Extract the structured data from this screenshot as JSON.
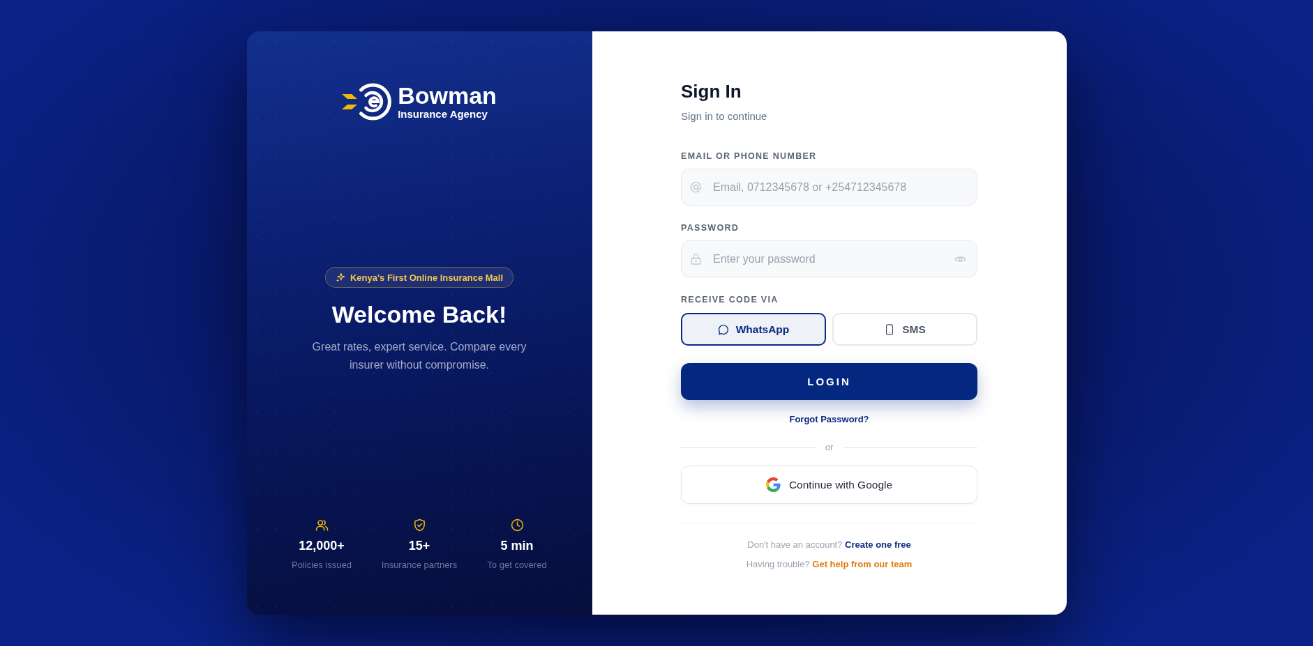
{
  "brand": {
    "name": "Bowman",
    "tagline": "Insurance Agency"
  },
  "hero": {
    "badge": "Kenya's First Online Insurance Mall",
    "title": "Welcome Back!",
    "subtitle": "Great rates, expert service. Compare every insurer without compromise."
  },
  "stats": [
    {
      "kind": "users",
      "value": "12,000+",
      "label": "Policies issued"
    },
    {
      "kind": "shield",
      "value": "15+",
      "label": "Insurance partners"
    },
    {
      "kind": "clock",
      "value": "5 min",
      "label": "To get covered"
    }
  ],
  "form": {
    "title": "Sign In",
    "subtitle": "Sign in to continue",
    "fields": [
      {
        "kind": "email",
        "label": "EMAIL OR PHONE NUMBER",
        "placeholder": "Email, 0712345678 or +254712345678"
      },
      {
        "kind": "password",
        "label": "PASSWORD",
        "placeholder": "Enter your password"
      }
    ],
    "code_channel": {
      "label": "RECEIVE CODE VIA",
      "options": [
        {
          "kind": "chat",
          "label": "WhatsApp",
          "selected": true
        },
        {
          "kind": "phone",
          "label": "SMS",
          "selected": false
        }
      ]
    },
    "submit": "LOGIN",
    "forgot": "Forgot Password?",
    "divider": "or",
    "google": "Continue with Google",
    "footer": [
      {
        "kind": "signup",
        "prompt": "Don't have an account?",
        "link": "Create one free"
      },
      {
        "kind": "help",
        "prompt": "Having trouble?",
        "link": "Get help from our team"
      }
    ]
  }
}
